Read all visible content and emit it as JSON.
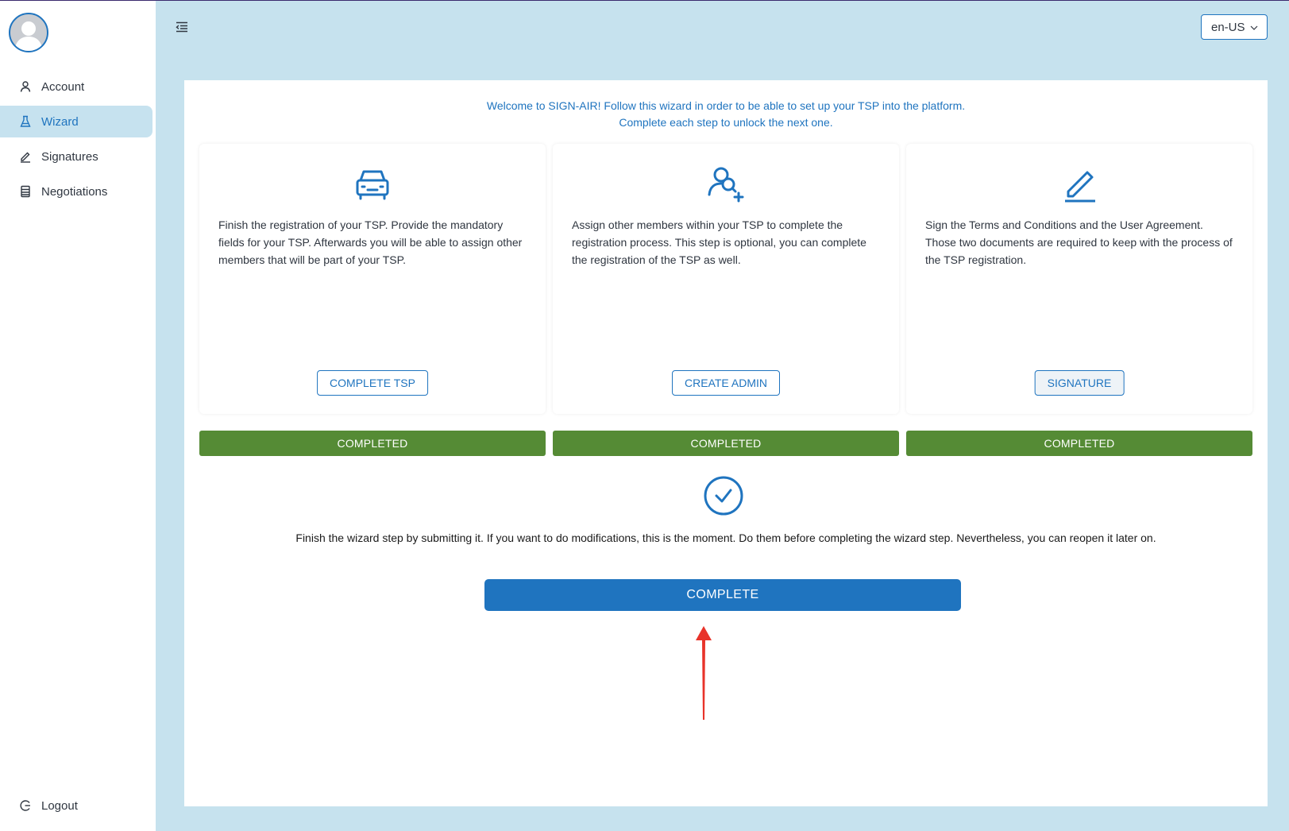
{
  "sidebar": {
    "items": [
      {
        "label": "Account",
        "icon": "user-icon",
        "active": false
      },
      {
        "label": "Wizard",
        "icon": "flask-icon",
        "active": true
      },
      {
        "label": "Signatures",
        "icon": "pen-icon",
        "active": false
      },
      {
        "label": "Negotiations",
        "icon": "ledger-icon",
        "active": false
      }
    ],
    "logout_label": "Logout"
  },
  "header": {
    "language": "en-US"
  },
  "wizard": {
    "intro_line1": "Welcome to SIGN-AIR! Follow this wizard in order to be able to set up your TSP into the platform.",
    "intro_line2": "Complete each step to unlock the next one.",
    "cards": [
      {
        "icon": "car-icon",
        "text": "Finish the registration of your TSP. Provide the mandatory fields for your TSP. Afterwards you will be able to assign other members that will be part of your TSP.",
        "button": "COMPLETE TSP",
        "status": "COMPLETED"
      },
      {
        "icon": "add-user-icon",
        "text": "Assign other members within your TSP to complete the registration process. This step is optional, you can complete the registration of the TSP as well.",
        "button": "CREATE ADMIN",
        "status": "COMPLETED"
      },
      {
        "icon": "signature-pen-icon",
        "text": "Sign the Terms and Conditions and the User Agreement. Those two documents are required to keep with the process of the TSP registration.",
        "button": "SIGNATURE",
        "status": "COMPLETED"
      }
    ],
    "finish_text": "Finish the wizard step by submitting it. If you want to do modifications, this is the moment. Do them before completing the wizard step. Nevertheless, you can reopen it later on.",
    "complete_button": "COMPLETE"
  },
  "colors": {
    "accent": "#1f74bf",
    "background": "#c6e2ee",
    "completed": "#558b35",
    "annotation_arrow": "#e8332a"
  }
}
